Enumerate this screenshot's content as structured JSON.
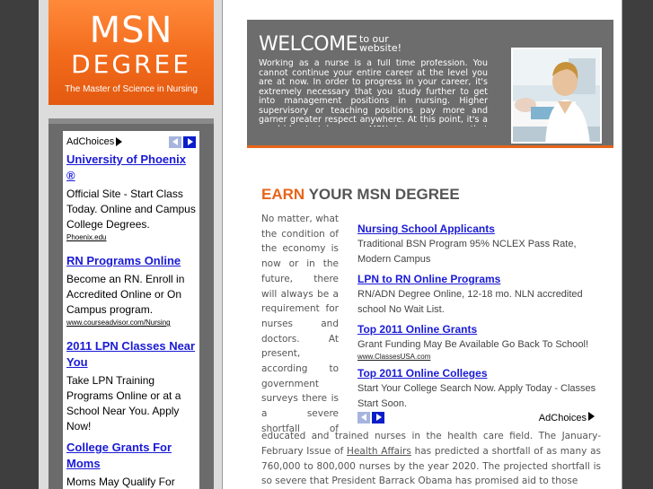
{
  "logo": {
    "line1": "MSN",
    "line2": "DEGREE",
    "tagline": "The Master of Science in Nursing"
  },
  "ad_choices_label": "AdChoices",
  "left_ads": [
    {
      "title": "University of Phoenix ®",
      "body": "Official Site - Start Class Today. Online and Campus College Degrees.",
      "url": "Phoenix.edu"
    },
    {
      "title": "RN Programs Online",
      "body": "Become an RN. Enroll in Accredited Online or On Campus program.",
      "url": "www.courseadvisor.com/Nursing"
    },
    {
      "title": "2011 LPN Classes Near You",
      "body": "Take LPN Training Programs Online or at a School Near You. Apply Now!",
      "url": ""
    },
    {
      "title": "College Grants For Moms",
      "body": "Moms May Qualify For Grants To Earn A Degree",
      "url": ""
    }
  ],
  "welcome": {
    "title_big": "WELCOME",
    "title_small": "to our website!",
    "text": "Working as a nurse is a full time profession. You cannot continue your entire career at the level you are at now. In order to progress in your career, it's extremely necessary that you study further to get into management positions in nursing. Higher supervisory or teaching positions pay more and garner greater respect anywhere. At this point, it's a good idea to take up an MSN degree to ensure that you are on the right track for career growth."
  },
  "section": {
    "heading_highlight": "EARN",
    "heading_rest": " YOUR MSN DEGREE",
    "body_narrow": "No matter, what the condition of the economy is now or in the future, there will always be a requirement for nurses and doctors. At present, according to government surveys there is a severe shortfall of",
    "body_wide_1": "educated and trained nurses in the health care field. The January-February Issue of ",
    "body_wide_link": "Health Affairs",
    "body_wide_2": " has predicted a shortfall of as many as 760,000 to 800,000 nurses by the year 2020. The projected shortfall is so severe that President Barrack Obama has promised aid to those"
  },
  "right_ads": [
    {
      "title": "Nursing School Applicants",
      "body": "Traditional BSN Program 95% NCLEX Pass Rate, Modern Campus",
      "url": ""
    },
    {
      "title": "LPN to RN Online Programs",
      "body": "RN/ADN Degree Online, 12-18 mo. NLN accredited school No Wait List.",
      "url": ""
    },
    {
      "title": "Top 2011 Online Grants",
      "body": "Grant Funding May Be Available Go Back To School!",
      "url": "www.ClassesUSA.com"
    },
    {
      "title": "Top 2011 Online Colleges",
      "body": "Start Your College Search Now. Apply Today - Classes Start Soon.",
      "url": ""
    }
  ],
  "colors": {
    "accent": "#e8641a",
    "link": "#1a1ad6",
    "panel": "#6d6d6d"
  },
  "icons": {
    "prev": "chevron-left-icon",
    "next": "chevron-right-icon",
    "adchoices": "adchoices-triangle-icon"
  }
}
